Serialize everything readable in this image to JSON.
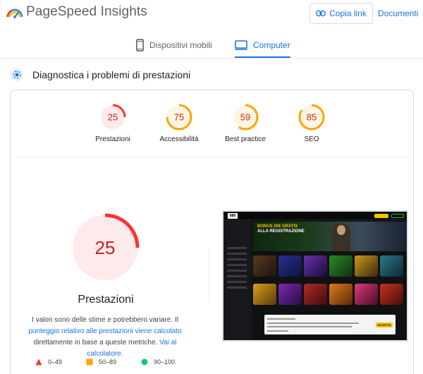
{
  "header": {
    "app_title": "PageSpeed Insights",
    "copy_link_label": "Copia link",
    "docs_label": "Documenti"
  },
  "tabs": [
    {
      "label": "Dispositivi mobili",
      "selected": false,
      "icon": "smartphone-icon"
    },
    {
      "label": "Computer",
      "selected": true,
      "icon": "desktop-icon"
    }
  ],
  "section": {
    "title": "Diagnostica i problemi di prestazioni"
  },
  "gauges": [
    {
      "score": 25,
      "label": "Prestazioni",
      "color": "#ff3333",
      "fill": "#fdeaea",
      "text_color": "#c5221f"
    },
    {
      "score": 75,
      "label": "Accessibilità",
      "color": "#ffa400",
      "fill": "#fff5e6",
      "text_color": "#c33300"
    },
    {
      "score": 59,
      "label": "Best practice",
      "color": "#ffa400",
      "fill": "#fff5e6",
      "text_color": "#c33300"
    },
    {
      "score": 85,
      "label": "SEO",
      "color": "#ffa400",
      "fill": "#fff5e6",
      "text_color": "#c33300"
    }
  ],
  "main": {
    "score": 25,
    "label": "Prestazioni",
    "description_part1": "I valori sono delle stime e potrebbero variare. Il ",
    "description_link1": "punteggio relativo alle prestazioni viene calcolato",
    "description_part2": " direttamente in base a queste metriche. ",
    "description_link2": "Vai al calcolatore."
  },
  "legend": [
    {
      "range": "0–49",
      "shape": "triangle",
      "color": "#ff3333"
    },
    {
      "range": "50–89",
      "shape": "square",
      "color": "#ffa400"
    },
    {
      "range": "90–100",
      "shape": "circle",
      "color": "#0cce6b"
    }
  ],
  "thumbnail": {
    "logo_text": "888",
    "banner_line1": "BONUS 20€ GRATIS",
    "banner_line2": "ALLA REGISTRAZIONE",
    "accept_label": "ACCETTA"
  },
  "colors": {
    "accent": "#1a73e8",
    "fail": "#ff3333",
    "average": "#ffa400",
    "pass": "#0cce6b"
  }
}
